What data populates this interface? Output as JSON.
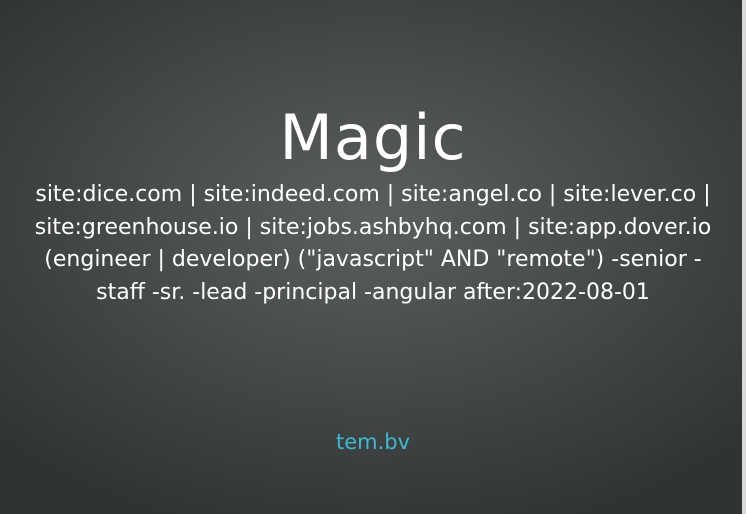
{
  "slide": {
    "title": "Magic",
    "query": "site:dice.com | site:indeed.com | site:angel.co | site:lever.co | site:greenhouse.io | site:jobs.ashbyhq.com | site:app.dover.io (engineer | developer) (\"javascript\" AND \"remote\") -senior -staff -sr. -lead -principal -angular after:2022-08-01",
    "footer_link": "tem.bv"
  },
  "colors": {
    "background": "#474b4b",
    "text": "#ffffff",
    "link": "#3fb8cf"
  }
}
